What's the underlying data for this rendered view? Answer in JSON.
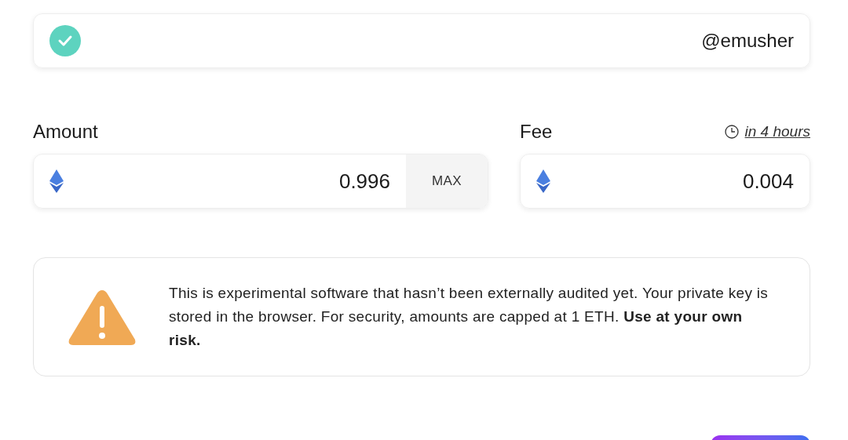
{
  "recipient": {
    "verified": true,
    "handle": "@emusher"
  },
  "amount": {
    "label": "Amount",
    "value": "0.996",
    "max_button": "MAX"
  },
  "fee": {
    "label": "Fee",
    "timing_link": "in 4 hours",
    "value": "0.004"
  },
  "warning": {
    "text": "This is experimental software that hasn’t been externally audited yet. Your private key is stored in the browser. For security, amounts are capped at 1 ETH. **Use at your own risk.**"
  }
}
